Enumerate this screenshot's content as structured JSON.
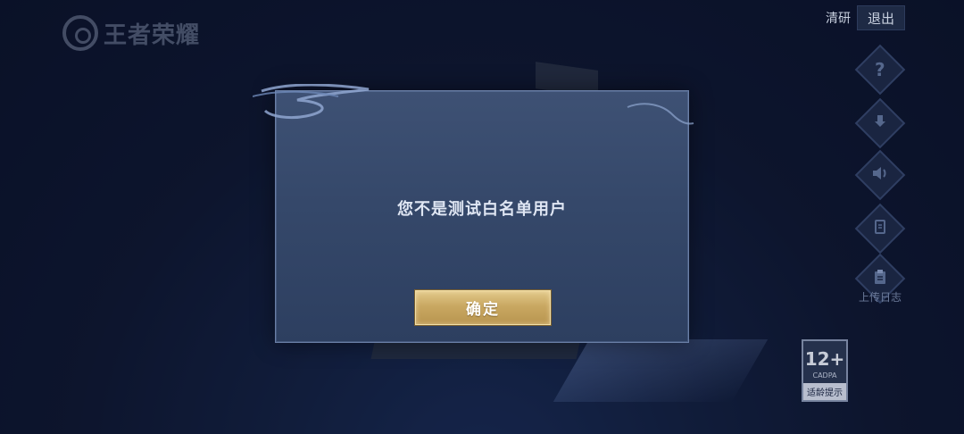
{
  "logo": {
    "text": "王者荣耀"
  },
  "topbar": {
    "quality_label": "清研",
    "exit_label": "退出"
  },
  "side_icons": {
    "help_glyph": "?",
    "upload_log_label": "上传日志"
  },
  "age_badge": {
    "rating": "12+",
    "org": "CADPA",
    "tip": "适龄提示"
  },
  "dialog": {
    "message": "您不是测试白名单用户",
    "confirm_label": "确定"
  },
  "colors": {
    "accent_gold": "#c9a862",
    "dialog_bg": "#35486a",
    "page_bg": "#111c38"
  }
}
